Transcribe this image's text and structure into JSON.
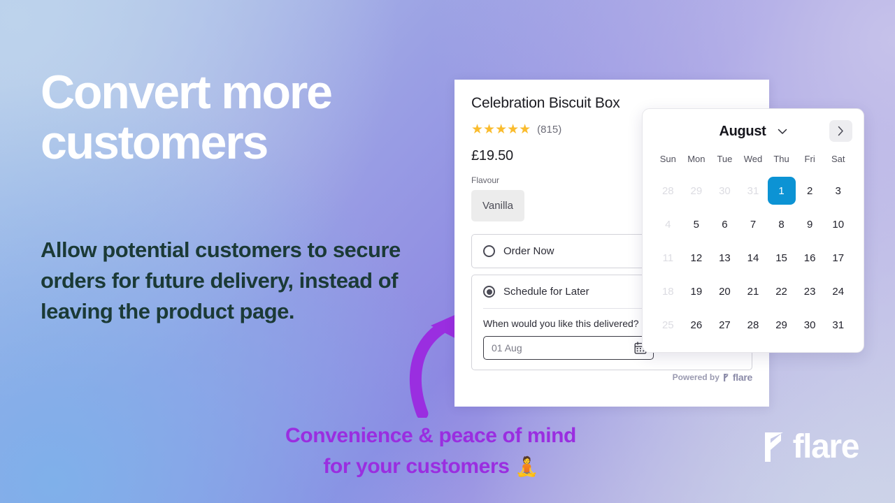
{
  "hero": {
    "headline": "Convert more customers",
    "subcopy": "Allow potential customers to secure orders for future delivery, instead of leaving the product page.",
    "caption_line1": "Convenience & peace of mind",
    "caption_line2": "for your customers",
    "caption_emoji": "🧘",
    "headline_color": "#ffffff",
    "subcopy_color": "#1b3a36",
    "caption_color": "#9a2ee0"
  },
  "brand": {
    "name": "flare"
  },
  "product": {
    "title": "Celebration Biscuit Box",
    "stars": "★★★★★",
    "rating_count": "(815)",
    "star_color": "#fabc2e",
    "price": "£19.50",
    "option_label": "Flavour",
    "option_value": "Vanilla"
  },
  "order_modes": [
    {
      "label": "Order Now",
      "selected": false
    },
    {
      "label": "Schedule for Later",
      "selected": true
    }
  ],
  "schedule": {
    "question": "When would you like this delivered?",
    "date_value": "01 Aug",
    "powered_by": "Powered by",
    "powered_brand": "flare"
  },
  "calendar": {
    "month": "August",
    "accent_color": "#0c93d4",
    "weekdays": [
      "Sun",
      "Mon",
      "Tue",
      "Wed",
      "Thu",
      "Fri",
      "Sat"
    ],
    "weeks": [
      [
        {
          "d": "28",
          "muted": true
        },
        {
          "d": "29",
          "muted": true
        },
        {
          "d": "30",
          "muted": true
        },
        {
          "d": "31",
          "muted": true
        },
        {
          "d": "1",
          "selected": true
        },
        {
          "d": "2"
        },
        {
          "d": "3"
        }
      ],
      [
        {
          "d": "4",
          "muted": true
        },
        {
          "d": "5"
        },
        {
          "d": "6"
        },
        {
          "d": "7"
        },
        {
          "d": "8"
        },
        {
          "d": "9"
        },
        {
          "d": "10"
        }
      ],
      [
        {
          "d": "11",
          "muted": true
        },
        {
          "d": "12"
        },
        {
          "d": "13"
        },
        {
          "d": "14"
        },
        {
          "d": "15"
        },
        {
          "d": "16"
        },
        {
          "d": "17"
        }
      ],
      [
        {
          "d": "18",
          "muted": true
        },
        {
          "d": "19"
        },
        {
          "d": "20"
        },
        {
          "d": "21"
        },
        {
          "d": "22"
        },
        {
          "d": "23"
        },
        {
          "d": "24"
        }
      ],
      [
        {
          "d": "25",
          "muted": true
        },
        {
          "d": "26"
        },
        {
          "d": "27"
        },
        {
          "d": "28"
        },
        {
          "d": "29"
        },
        {
          "d": "30"
        },
        {
          "d": "31"
        }
      ]
    ]
  }
}
